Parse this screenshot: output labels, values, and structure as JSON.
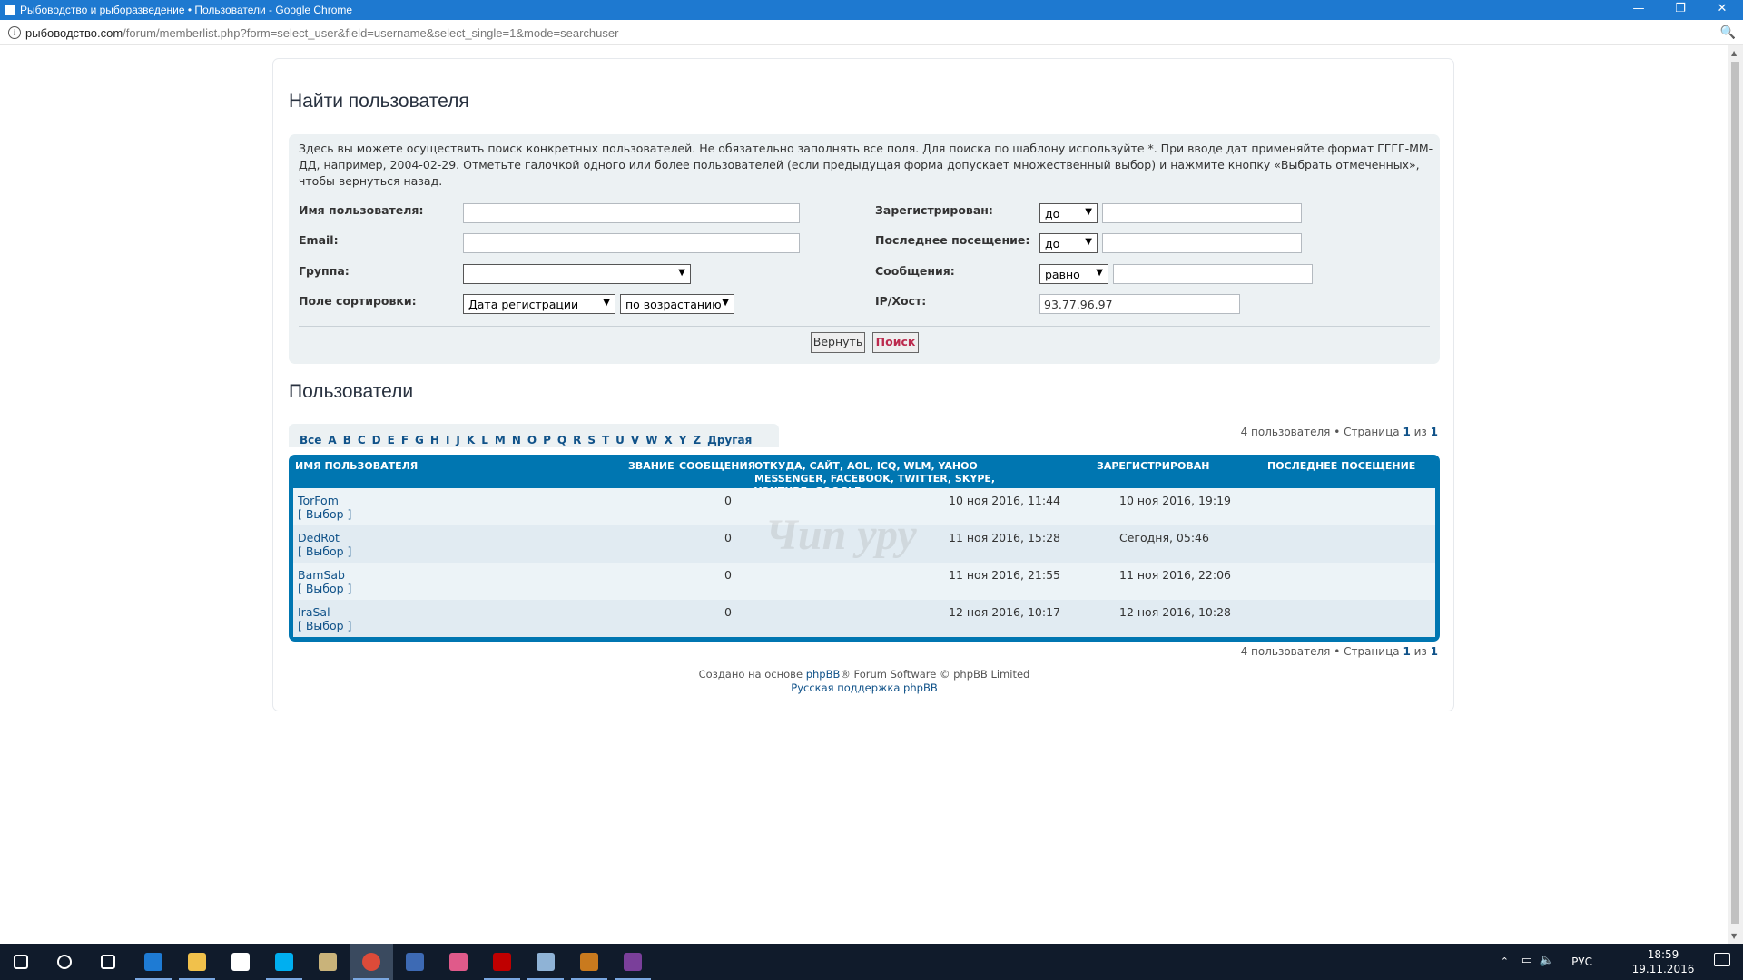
{
  "window": {
    "title": "Рыбоводство и рыборазведение • Пользователи - Google Chrome",
    "controls": [
      "—",
      "❐",
      "✕"
    ]
  },
  "address_bar": {
    "host": "рыбоводство.com",
    "path": "/forum/memberlist.php?form=select_user&field=username&select_single=1&mode=searchuser"
  },
  "search_section": {
    "title": "Найти пользователя",
    "intro": "Здесь вы можете осуществить поиск конкретных пользователей. Не обязательно заполнять все поля. Для поиска по шаблону используйте *. При вводе дат применяйте формат ГГГГ-ММ-ДД, например, 2004-02-29. Отметьте галочкой одного или более пользователей (если предыдущая форма допускает множественный выбор) и нажмите кнопку «Выбрать отмеченных», чтобы вернуться назад.",
    "fields": {
      "username_label": "Имя пользователя:",
      "username_value": "",
      "email_label": "Email:",
      "email_value": "",
      "group_label": "Группа:",
      "group_value": "",
      "sort_label": "Поле сортировки:",
      "sort_field": "Дата регистрации",
      "sort_dir": "по возрастанию",
      "registered_label": "Зарегистрирован:",
      "registered_op": "до",
      "registered_value": "",
      "last_visit_label": "Последнее посещение:",
      "last_visit_op": "до",
      "last_visit_value": "",
      "posts_label": "Сообщения:",
      "posts_op": "равно",
      "posts_value": "",
      "ip_label": "IP/Хост:",
      "ip_value": "93.77.96.97"
    },
    "buttons": {
      "reset": "Вернуть",
      "search": "Поиск"
    }
  },
  "users_section": {
    "title": "Пользователи",
    "letters": [
      "Все",
      "A",
      "B",
      "C",
      "D",
      "E",
      "F",
      "G",
      "H",
      "I",
      "J",
      "K",
      "L",
      "M",
      "N",
      "O",
      "P",
      "Q",
      "R",
      "S",
      "T",
      "U",
      "V",
      "W",
      "X",
      "Y",
      "Z",
      "Другая"
    ],
    "pagination": {
      "count": "4 пользователя",
      "page_word": "Страница",
      "current": "1",
      "of_word": "из",
      "total": "1"
    },
    "columns": {
      "username": "ИМЯ ПОЛЬЗОВАТЕЛЯ",
      "rank": "ЗВАНИЕ",
      "posts": "СООБЩЕНИЯ",
      "from": "ОТКУДА, САЙТ, AOL, ICQ, WLM, YAHOO MESSENGER, FACEBOOK, TWITTER, SKYPE, YOUTUBE, GOOGLE+",
      "joined": "ЗАРЕГИСТРИРОВАН",
      "last_visit": "ПОСЛЕДНЕЕ ПОСЕЩЕНИЕ"
    },
    "pick_label": "[ Выбор ]",
    "rows": [
      {
        "name": "TorFom",
        "posts": "0",
        "joined": "10 ноя 2016, 11:44",
        "last_visit": "10 ноя 2016, 19:19"
      },
      {
        "name": "DedRot",
        "posts": "0",
        "joined": "11 ноя 2016, 15:28",
        "last_visit": "Сегодня, 05:46"
      },
      {
        "name": "BamSab",
        "posts": "0",
        "joined": "11 ноя 2016, 21:55",
        "last_visit": "11 ноя 2016, 22:06"
      },
      {
        "name": "IraSal",
        "posts": "0",
        "joined": "12 ноя 2016, 10:17",
        "last_visit": "12 ноя 2016, 10:28"
      }
    ]
  },
  "footer": {
    "created_prefix": "Создано на основе",
    "phpbb_link": "phpBB",
    "created_suffix": "® Forum Software © phpBB Limited",
    "support_link": "Русская поддержка phpBB"
  },
  "watermark": "Чип уру",
  "taskbar": {
    "apps": [
      "windows-start",
      "search",
      "task-view",
      "edge",
      "file-explorer",
      "store",
      "skype",
      "paint-tool",
      "chrome",
      "thunderbird",
      "picasa",
      "filezilla",
      "notepad",
      "sublime-text",
      "winrar"
    ],
    "lang": "РУС",
    "time": "18:59",
    "date": "19.11.2016"
  },
  "colors": {
    "titlebar": "#1e79d0",
    "panel_bg": "#ecf1f3",
    "table_header": "#0076b1",
    "row_even": "#ecf3f7",
    "row_odd": "#e1ebf2",
    "link": "#105289",
    "search_button_text": "#bc2a4d",
    "taskbar": "#101b2b"
  }
}
